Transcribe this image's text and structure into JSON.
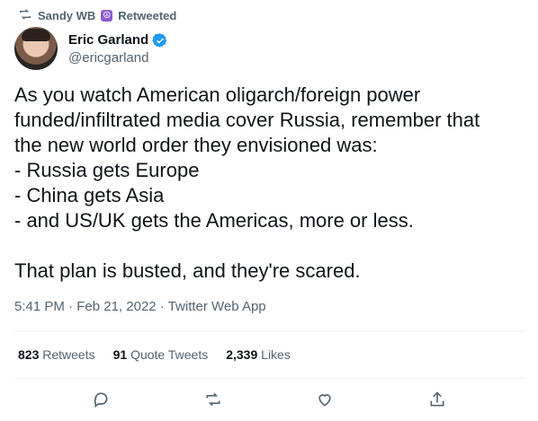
{
  "retweet": {
    "user": "Sandy WB",
    "emoji": "☮",
    "label": "Retweeted"
  },
  "author": {
    "name": "Eric Garland",
    "handle": "@ericgarland"
  },
  "tweet": {
    "text": "As you watch American oligarch/foreign power\nfunded/infiltrated media cover Russia, remember that\nthe new world order they envisioned was:\n- Russia gets Europe\n- China gets Asia\n- and US/UK gets the Americas, more or less.\n\nThat plan is busted, and they're scared."
  },
  "meta": {
    "time": "5:41 PM",
    "sep1": "·",
    "date": "Feb 21, 2022",
    "sep2": "·",
    "source": "Twitter Web App"
  },
  "stats": {
    "retweets_count": "823",
    "retweets_label": "Retweets",
    "quotes_count": "91",
    "quotes_label": "Quote Tweets",
    "likes_count": "2,339",
    "likes_label": "Likes"
  },
  "colors": {
    "secondary": "#536471",
    "verified": "#1d9bf0"
  },
  "icons": [
    "retweet-icon",
    "verified-icon",
    "reply-icon",
    "retweet-icon",
    "like-icon",
    "share-icon"
  ]
}
